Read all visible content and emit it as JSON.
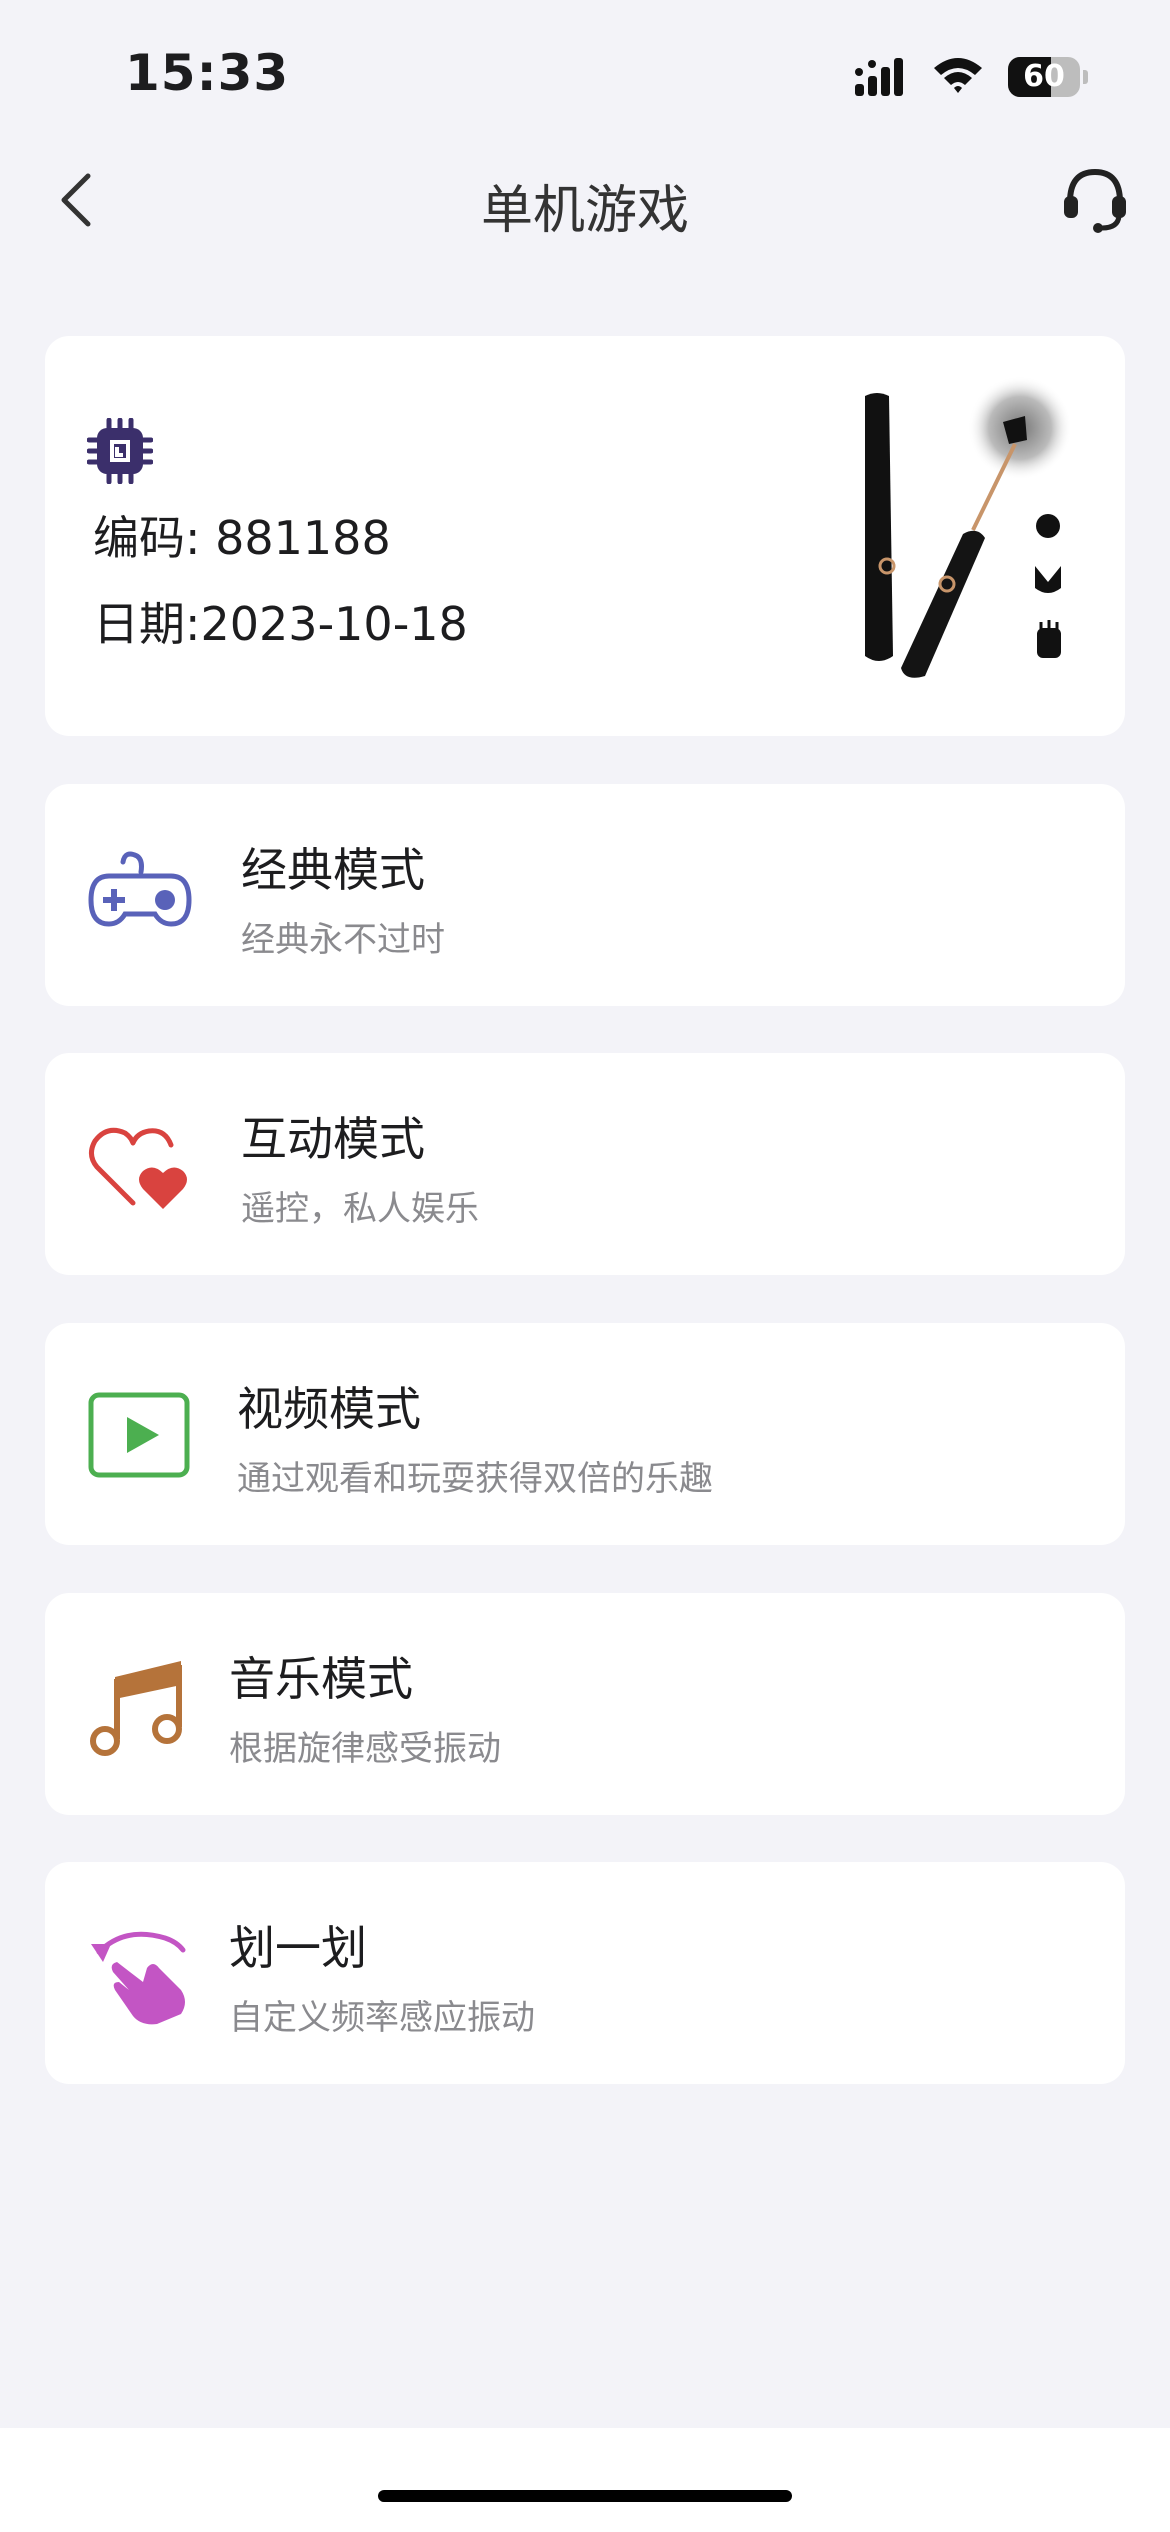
{
  "status_bar": {
    "time": "15:33",
    "battery_percent": "60",
    "battery_level": 0.6,
    "icons": [
      "signal-icon",
      "wifi-icon",
      "battery-icon"
    ]
  },
  "nav": {
    "title": "单机游戏",
    "back_icon": "chevron-left-icon",
    "support_icon": "headset-icon"
  },
  "device": {
    "code_line": "编码: 881188",
    "date_line": "日期:2023-10-18",
    "chip_icon": "chip-icon",
    "product_image": "vibrator-product-image"
  },
  "modes": [
    {
      "title": "经典模式",
      "subtitle": "经典永不过时",
      "icon": "gamepad-icon",
      "color": "#5962b9"
    },
    {
      "title": "互动模式",
      "subtitle": "遥控，私人娱乐",
      "icon": "hearts-icon",
      "color": "#d9433f"
    },
    {
      "title": "视频模式",
      "subtitle": "通过观看和玩耍获得双倍的乐趣",
      "icon": "video-play-icon",
      "color": "#4caf50"
    },
    {
      "title": "音乐模式",
      "subtitle": "根据旋律感受振动",
      "icon": "music-note-icon",
      "color": "#b5733a"
    },
    {
      "title": "划一划",
      "subtitle": "自定义频率感应振动",
      "icon": "swipe-hand-icon",
      "color": "#c355c4"
    }
  ]
}
